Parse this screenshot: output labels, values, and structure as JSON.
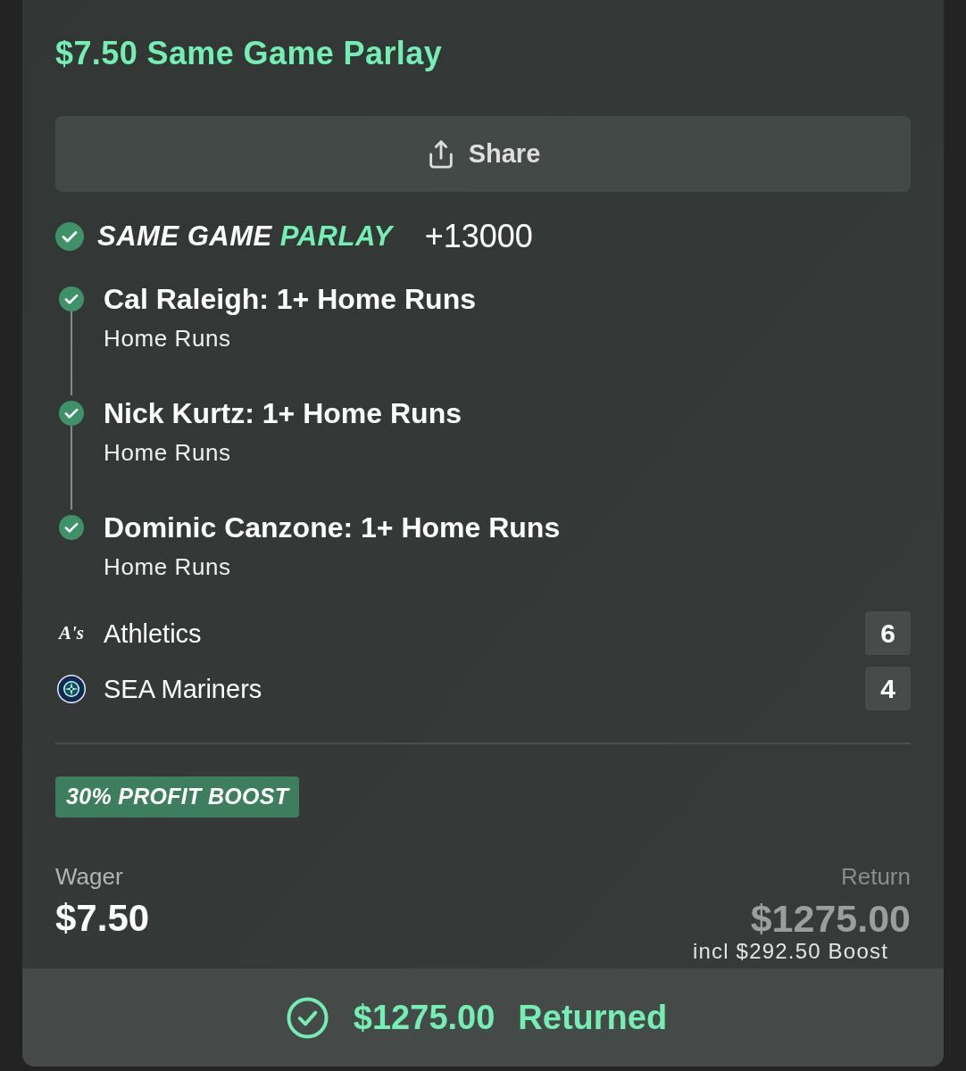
{
  "bet": {
    "title": "$7.50 Same Game Parlay"
  },
  "share_button": {
    "label": "Share"
  },
  "parlay": {
    "won": true,
    "label": "SAME GAME",
    "label_accent": "PARLAY",
    "odds": "+13000"
  },
  "legs": [
    {
      "won": true,
      "selection": "Cal Raleigh: 1+ Home Runs",
      "market": "Home Runs"
    },
    {
      "won": true,
      "selection": "Nick Kurtz: 1+ Home Runs",
      "market": "Home Runs"
    },
    {
      "won": true,
      "selection": "Dominic Canzone: 1+ Home Runs",
      "market": "Home Runs"
    }
  ],
  "teams": [
    {
      "logo": {
        "kind": "wordmark",
        "text": "A's"
      },
      "name": "Athletics",
      "score": "6"
    },
    {
      "logo": {
        "kind": "compass"
      },
      "name": "SEA Mariners",
      "score": "4"
    }
  ],
  "boost_badge": {
    "label": "30% PROFIT BOOST"
  },
  "wager": {
    "label": "Wager",
    "value": "$7.50"
  },
  "return": {
    "label": "Return",
    "value": "$1275.00",
    "note": "incl $292.50 Boost"
  },
  "footer": {
    "settled": true,
    "amount": "$1275.00",
    "label": "Returned"
  }
}
